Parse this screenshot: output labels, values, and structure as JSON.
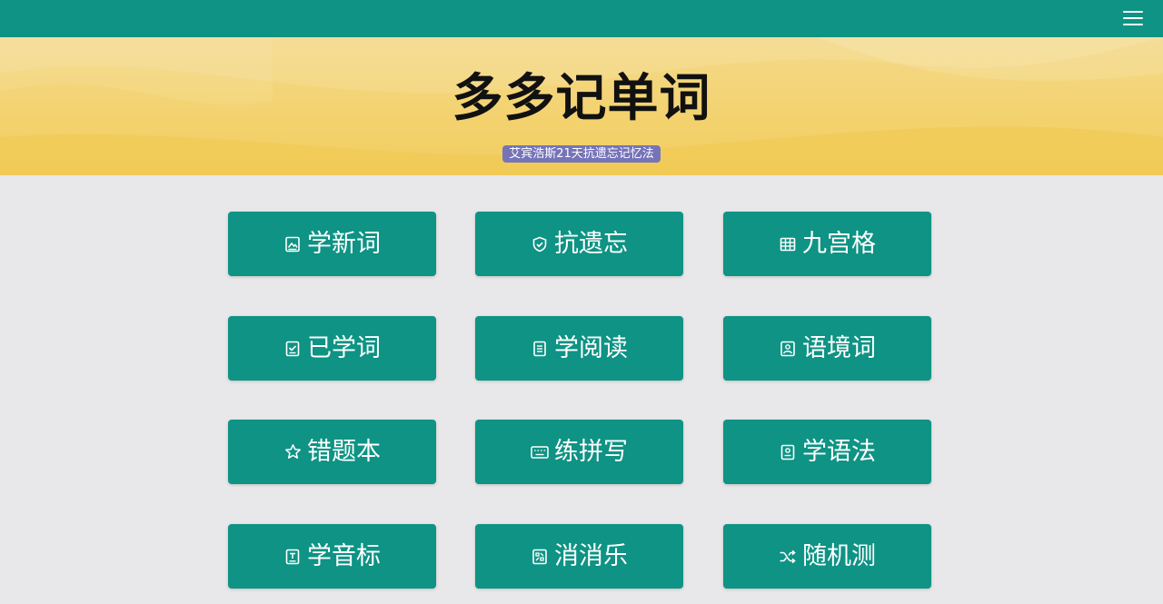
{
  "header": {
    "menu_icon": "hamburger-menu-icon"
  },
  "banner": {
    "title": "多多记单词",
    "subtitle": "艾宾浩斯21天抗遗忘记忆法"
  },
  "colors": {
    "primary": "#0e9384",
    "banner": "#f3d26e",
    "badge": "#7574b9",
    "background": "#e8e8ea"
  },
  "tiles": [
    {
      "label": "学新词",
      "icon": "image-frame-icon"
    },
    {
      "label": "抗遗忘",
      "icon": "shield-icon"
    },
    {
      "label": "九宫格",
      "icon": "grid-icon"
    },
    {
      "label": "已学词",
      "icon": "checkbox-icon"
    },
    {
      "label": "学阅读",
      "icon": "document-icon"
    },
    {
      "label": "语境词",
      "icon": "picture-icon"
    },
    {
      "label": "错题本",
      "icon": "star-icon"
    },
    {
      "label": "练拼写",
      "icon": "keyboard-icon"
    },
    {
      "label": "学语法",
      "icon": "id-card-icon"
    },
    {
      "label": "学音标",
      "icon": "phonetic-card-icon"
    },
    {
      "label": "消消乐",
      "icon": "puzzle-icon"
    },
    {
      "label": "随机测",
      "icon": "shuffle-icon"
    }
  ]
}
